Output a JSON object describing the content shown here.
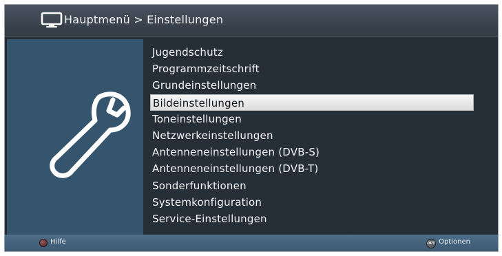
{
  "header": {
    "icon": "tv-icon",
    "breadcrumb": "Hauptmenü > Einstellungen"
  },
  "left_panel": {
    "icon": "wrench-icon"
  },
  "menu": {
    "selected_index": 3,
    "items": [
      {
        "label": "Jugendschutz"
      },
      {
        "label": "Programmzeitschrift"
      },
      {
        "label": "Grundeinstellungen"
      },
      {
        "label": "Bildeinstellungen"
      },
      {
        "label": "Toneinstellungen"
      },
      {
        "label": "Netzwerkeinstellungen"
      },
      {
        "label": "Antenneneinstellungen (DVB-S)"
      },
      {
        "label": "Antenneneinstellungen (DVB-T)"
      },
      {
        "label": "Sonderfunktionen"
      },
      {
        "label": "Systemkonfiguration"
      },
      {
        "label": "Service-Einstellungen"
      }
    ]
  },
  "footer": {
    "help": {
      "icon": "red-button-icon",
      "label": "Hilfe"
    },
    "options": {
      "icon": "opt-button-icon",
      "button_text": "OPT",
      "label": "Optionen"
    }
  },
  "colors": {
    "background": "#262e38",
    "header": "#3a434e",
    "left_panel": "#35546e",
    "footer": "#46647d",
    "selected_bar": "#e6e6e6",
    "text": "#f4f6f8"
  }
}
